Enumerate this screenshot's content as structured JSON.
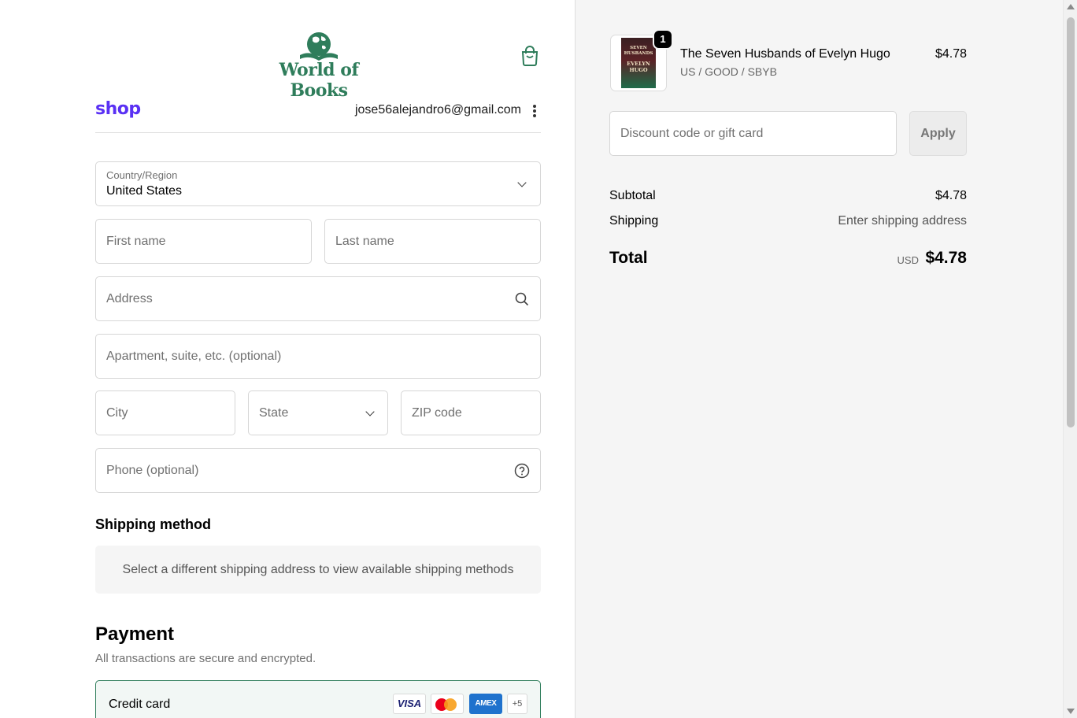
{
  "brand": {
    "name": "World of Books",
    "accent_color": "#2f7d5b",
    "shop_pay_label": "shop",
    "shop_color": "#5a31f4"
  },
  "account": {
    "email": "jose56alejandro6@gmail.com"
  },
  "delivery": {
    "country_label": "Country/Region",
    "country_value": "United States",
    "first_name_placeholder": "First name",
    "last_name_placeholder": "Last name",
    "address_placeholder": "Address",
    "apartment_placeholder": "Apartment, suite, etc. (optional)",
    "city_placeholder": "City",
    "state_placeholder": "State",
    "zip_placeholder": "ZIP code",
    "phone_placeholder": "Phone (optional)"
  },
  "shipping_method": {
    "title": "Shipping method",
    "message": "Select a different shipping address to view available shipping methods"
  },
  "payment": {
    "title": "Payment",
    "subtitle": "All transactions are secure and encrypted.",
    "credit_card_label": "Credit card",
    "card_brands": [
      "VISA",
      "Mastercard",
      "AMEX"
    ],
    "more_brands": "+5"
  },
  "order": {
    "item": {
      "name": "The Seven Husbands of Evelyn Hugo",
      "variant": "US / GOOD / SBYB",
      "price": "$4.78",
      "quantity": "1"
    },
    "discount_placeholder": "Discount code or gift card",
    "apply_label": "Apply",
    "subtotal_label": "Subtotal",
    "subtotal_value": "$4.78",
    "shipping_label": "Shipping",
    "shipping_value": "Enter shipping address",
    "total_label": "Total",
    "total_currency": "USD",
    "total_value": "$4.78"
  }
}
